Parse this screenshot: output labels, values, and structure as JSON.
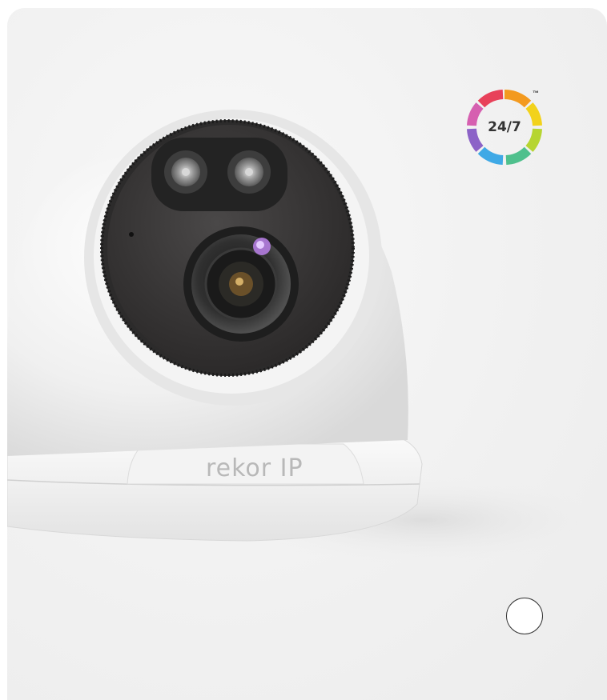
{
  "badge": {
    "text": "24/7",
    "trademark": "™",
    "segment_colors": [
      "#e8415a",
      "#f39a1f",
      "#f2d21b",
      "#b6d531",
      "#4fc08d",
      "#3fa9e6",
      "#8c63c7",
      "#d660b0"
    ]
  },
  "product": {
    "brand_logo": "rekor IP",
    "body_color": "#f2f2f2",
    "faceplate_color": "#3a3a3a"
  },
  "colors": {
    "background": "#f1f1f1"
  }
}
